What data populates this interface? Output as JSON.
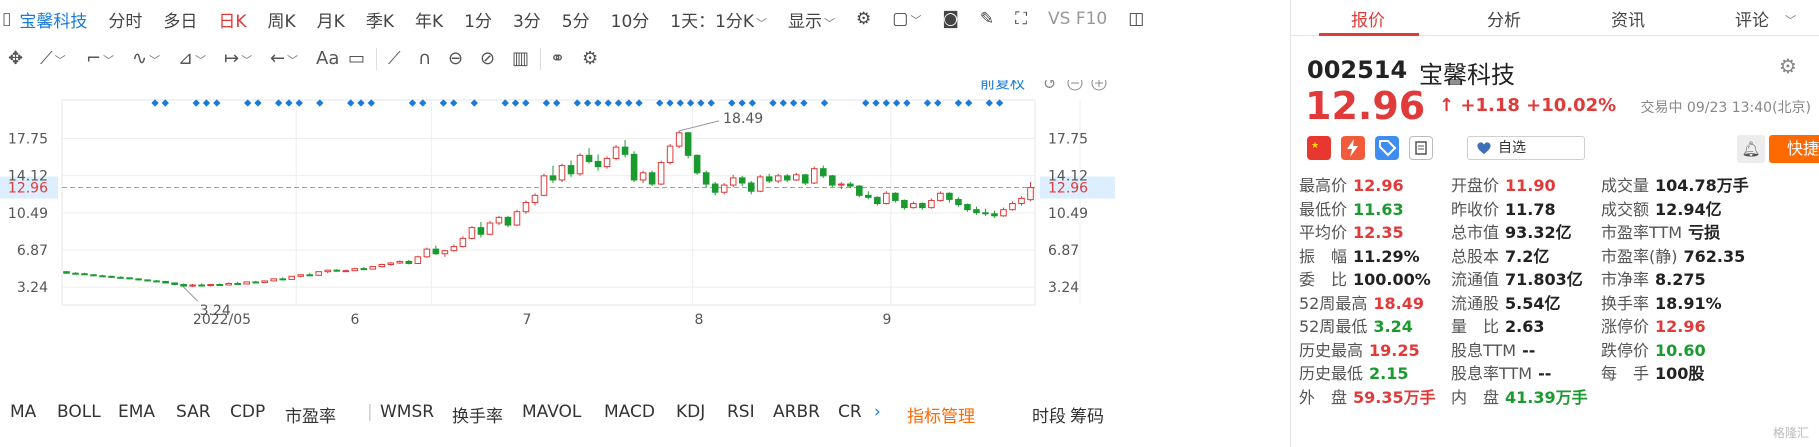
{
  "header": {
    "stock_name": "宝馨科技",
    "periods": [
      "分时",
      "多日",
      "日K",
      "周K",
      "月K",
      "季K",
      "年K",
      "1分",
      "3分",
      "5分",
      "10分",
      "1天：1分K"
    ],
    "active_period": "日K",
    "display_label": "显示",
    "vs_label": "VS F10"
  },
  "chart": {
    "adjust_label": "前复权",
    "price_ticks": [
      "17.75",
      "14.12",
      "10.49",
      "6.87",
      "3.24"
    ],
    "current_price_tag": "12.96",
    "x_ticks": [
      "2022/05",
      "6",
      "7",
      "8",
      "9"
    ],
    "high_label": "18.49",
    "low_label": "3.24",
    "colors": {
      "up": "#e03a3a",
      "down": "#1a9a2f",
      "marker": "#1a7ad9",
      "price_line": "#ff8c1a"
    }
  },
  "chart_data": {
    "type": "candlestick",
    "ylim": [
      1.5,
      21.5
    ],
    "x_axis_ticks": [
      "2022/05",
      "6",
      "7",
      "8",
      "9"
    ],
    "y_axis_ticks": [
      3.24,
      6.87,
      10.49,
      14.12,
      17.75
    ],
    "current_price": 12.96,
    "marked_high": 18.49,
    "marked_low": 3.24,
    "ohlc": [
      [
        4.75,
        4.8,
        4.55,
        4.6
      ],
      [
        4.6,
        4.7,
        4.5,
        4.55
      ],
      [
        4.55,
        4.65,
        4.4,
        4.45
      ],
      [
        4.45,
        4.5,
        4.3,
        4.35
      ],
      [
        4.35,
        4.45,
        4.25,
        4.3
      ],
      [
        4.3,
        4.35,
        4.15,
        4.2
      ],
      [
        4.2,
        4.3,
        4.1,
        4.15
      ],
      [
        4.15,
        4.2,
        4.0,
        4.05
      ],
      [
        4.05,
        4.1,
        3.9,
        3.95
      ],
      [
        3.95,
        4.0,
        3.8,
        3.85
      ],
      [
        3.85,
        3.95,
        3.75,
        3.8
      ],
      [
        3.8,
        3.85,
        3.6,
        3.65
      ],
      [
        3.65,
        3.7,
        3.45,
        3.5
      ],
      [
        3.5,
        3.6,
        3.24,
        3.35
      ],
      [
        3.35,
        3.55,
        3.25,
        3.45
      ],
      [
        3.45,
        3.6,
        3.35,
        3.4
      ],
      [
        3.4,
        3.55,
        3.3,
        3.5
      ],
      [
        3.5,
        3.6,
        3.35,
        3.45
      ],
      [
        3.45,
        3.7,
        3.4,
        3.6
      ],
      [
        3.6,
        3.75,
        3.5,
        3.55
      ],
      [
        3.55,
        3.8,
        3.5,
        3.75
      ],
      [
        3.75,
        3.85,
        3.6,
        3.7
      ],
      [
        3.7,
        3.9,
        3.65,
        3.85
      ],
      [
        3.85,
        4.1,
        3.8,
        4.05
      ],
      [
        4.05,
        4.2,
        3.9,
        4.0
      ],
      [
        4.0,
        4.35,
        3.95,
        4.3
      ],
      [
        4.3,
        4.5,
        4.2,
        4.45
      ],
      [
        4.45,
        4.6,
        4.3,
        4.4
      ],
      [
        4.4,
        4.8,
        4.35,
        4.75
      ],
      [
        4.75,
        4.95,
        4.6,
        4.9
      ],
      [
        4.9,
        5.0,
        4.75,
        4.8
      ],
      [
        4.8,
        4.95,
        4.7,
        4.85
      ],
      [
        4.85,
        5.1,
        4.8,
        5.05
      ],
      [
        5.05,
        5.2,
        4.9,
        5.0
      ],
      [
        5.0,
        5.3,
        4.95,
        5.25
      ],
      [
        5.25,
        5.55,
        5.15,
        5.45
      ],
      [
        5.45,
        5.7,
        5.3,
        5.6
      ],
      [
        5.6,
        5.85,
        5.5,
        5.75
      ],
      [
        5.75,
        5.9,
        5.45,
        5.55
      ],
      [
        5.55,
        6.3,
        5.5,
        6.2
      ],
      [
        6.2,
        7.1,
        6.1,
        6.95
      ],
      [
        6.95,
        7.3,
        6.4,
        6.5
      ],
      [
        6.5,
        6.9,
        6.2,
        6.8
      ],
      [
        6.8,
        7.4,
        6.7,
        7.2
      ],
      [
        7.2,
        8.2,
        7.1,
        8.0
      ],
      [
        8.0,
        9.2,
        7.9,
        9.05
      ],
      [
        9.05,
        9.6,
        8.1,
        8.4
      ],
      [
        8.4,
        9.7,
        8.3,
        9.5
      ],
      [
        9.5,
        10.2,
        9.3,
        10.05
      ],
      [
        10.05,
        10.2,
        9.1,
        9.3
      ],
      [
        9.3,
        10.8,
        9.2,
        10.6
      ],
      [
        10.6,
        11.7,
        10.4,
        11.5
      ],
      [
        11.5,
        12.4,
        11.2,
        12.2
      ],
      [
        12.2,
        14.3,
        12.1,
        14.1
      ],
      [
        14.1,
        15.1,
        13.4,
        13.7
      ],
      [
        13.7,
        15.3,
        13.5,
        15.1
      ],
      [
        15.1,
        15.6,
        14.0,
        14.3
      ],
      [
        14.3,
        16.3,
        14.1,
        16.1
      ],
      [
        16.1,
        16.8,
        15.3,
        15.5
      ],
      [
        15.5,
        16.2,
        14.6,
        15.0
      ],
      [
        15.0,
        16.0,
        14.8,
        15.8
      ],
      [
        15.8,
        17.1,
        15.6,
        16.9
      ],
      [
        16.9,
        17.6,
        15.9,
        16.2
      ],
      [
        16.2,
        16.5,
        13.5,
        13.7
      ],
      [
        13.7,
        14.6,
        13.4,
        14.4
      ],
      [
        14.4,
        14.6,
        13.1,
        13.3
      ],
      [
        13.3,
        15.6,
        13.2,
        15.4
      ],
      [
        15.4,
        17.2,
        15.2,
        17.0
      ],
      [
        17.0,
        18.49,
        16.8,
        18.3
      ],
      [
        18.3,
        18.4,
        15.8,
        16.1
      ],
      [
        16.1,
        16.2,
        14.2,
        14.4
      ],
      [
        14.4,
        14.6,
        13.0,
        13.3
      ],
      [
        13.3,
        13.5,
        12.2,
        12.5
      ],
      [
        12.5,
        13.4,
        12.3,
        13.2
      ],
      [
        13.2,
        14.2,
        13.0,
        13.9
      ],
      [
        13.9,
        14.1,
        13.1,
        13.4
      ],
      [
        13.4,
        13.6,
        12.3,
        12.6
      ],
      [
        12.6,
        14.2,
        12.5,
        14.0
      ],
      [
        14.0,
        14.3,
        13.4,
        13.6
      ],
      [
        13.6,
        14.3,
        13.4,
        14.1
      ],
      [
        14.1,
        14.3,
        13.5,
        13.7
      ],
      [
        13.7,
        14.4,
        13.6,
        14.2
      ],
      [
        14.2,
        14.3,
        13.2,
        13.4
      ],
      [
        13.4,
        15.0,
        13.3,
        14.8
      ],
      [
        14.8,
        15.1,
        13.9,
        14.1
      ],
      [
        14.1,
        14.2,
        13.0,
        13.2
      ],
      [
        13.2,
        13.5,
        12.8,
        13.3
      ],
      [
        13.3,
        13.5,
        12.9,
        13.1
      ],
      [
        13.1,
        13.2,
        12.0,
        12.2
      ],
      [
        12.2,
        12.6,
        11.8,
        12.0
      ],
      [
        12.0,
        12.1,
        11.2,
        11.4
      ],
      [
        11.4,
        12.6,
        11.3,
        12.4
      ],
      [
        12.4,
        12.5,
        11.5,
        11.7
      ],
      [
        11.7,
        11.8,
        10.8,
        11.0
      ],
      [
        11.0,
        11.6,
        10.9,
        11.4
      ],
      [
        11.4,
        11.5,
        10.8,
        11.0
      ],
      [
        11.0,
        11.9,
        10.9,
        11.7
      ],
      [
        11.7,
        12.6,
        11.6,
        12.4
      ],
      [
        12.4,
        12.5,
        11.5,
        11.8
      ],
      [
        11.8,
        12.0,
        11.1,
        11.3
      ],
      [
        11.3,
        11.4,
        10.6,
        10.8
      ],
      [
        10.8,
        11.1,
        10.3,
        10.5
      ],
      [
        10.5,
        10.9,
        10.2,
        10.4
      ],
      [
        10.4,
        10.7,
        10.0,
        10.2
      ],
      [
        10.2,
        11.0,
        10.1,
        10.8
      ],
      [
        10.8,
        11.6,
        10.7,
        11.4
      ],
      [
        11.4,
        12.1,
        11.2,
        11.9
      ],
      [
        11.78,
        13.5,
        11.63,
        12.96
      ]
    ],
    "signal_marker_groups": [
      [
        0,
        1
      ],
      [
        4,
        5,
        6
      ],
      [
        9,
        10
      ],
      [
        12,
        13,
        14
      ],
      [
        16
      ],
      [
        19,
        20,
        21
      ],
      [
        25,
        26
      ],
      [
        28,
        29
      ],
      [
        31
      ],
      [
        34,
        35,
        36
      ],
      [
        38,
        39
      ],
      [
        41,
        42,
        43,
        44,
        45,
        46,
        47
      ],
      [
        49,
        50,
        51,
        52,
        53,
        54
      ],
      [
        56,
        57,
        58
      ],
      [
        60,
        61,
        62,
        63
      ],
      [
        65
      ],
      [
        69,
        70,
        71,
        72,
        73
      ],
      [
        75,
        76
      ],
      [
        78,
        79
      ],
      [
        81,
        82
      ]
    ]
  },
  "toolbar_bottom": {
    "indicators": [
      "MA",
      "BOLL",
      "EMA",
      "SAR",
      "CDP",
      "市盈率",
      "WMSR",
      "换手率",
      "MAVOL",
      "MACD",
      "KDJ",
      "RSI",
      "ARBR",
      "CR"
    ],
    "manage_label": "指标管理",
    "right_labels": [
      "时段",
      "筹码"
    ]
  },
  "quote": {
    "tabs": [
      "报价",
      "分析",
      "资讯",
      "评论"
    ],
    "active_tab": "报价",
    "code": "002514",
    "name": "宝馨科技",
    "price": "12.96",
    "arrow": "↑",
    "change": "+1.18",
    "change_pct": "+10.02%",
    "status": "交易中 09/23 13:40(北京)",
    "watch_label": "自选",
    "trade_label": "快捷交易",
    "fields": [
      {
        "label": "最高价",
        "value": "12.96",
        "tone": "red"
      },
      {
        "label": "开盘价",
        "value": "11.90",
        "tone": "red"
      },
      {
        "label": "成交量",
        "value": "104.78万手",
        "tone": "dark"
      },
      {
        "label": "最低价",
        "value": "11.63",
        "tone": "green"
      },
      {
        "label": "昨收价",
        "value": "11.78",
        "tone": "dark"
      },
      {
        "label": "成交额",
        "value": "12.94亿",
        "tone": "dark"
      },
      {
        "label": "平均价",
        "value": "12.35",
        "tone": "red"
      },
      {
        "label": "总市值",
        "value": "93.32亿",
        "tone": "dark"
      },
      {
        "label": "市盈率TTM",
        "value": "亏损",
        "tone": "dark"
      },
      {
        "label": "振　幅",
        "value": "11.29%",
        "tone": "dark"
      },
      {
        "label": "总股本",
        "value": "7.2亿",
        "tone": "dark"
      },
      {
        "label": "市盈率(静)",
        "value": "762.35",
        "tone": "dark"
      },
      {
        "label": "委　比",
        "value": "100.00%",
        "tone": "dark"
      },
      {
        "label": "流通值",
        "value": "71.803亿",
        "tone": "dark"
      },
      {
        "label": "市净率",
        "value": "8.275",
        "tone": "dark"
      },
      {
        "label": "52周最高",
        "value": "18.49",
        "tone": "red"
      },
      {
        "label": "流通股",
        "value": "5.54亿",
        "tone": "dark"
      },
      {
        "label": "换手率",
        "value": "18.91%",
        "tone": "dark"
      },
      {
        "label": "52周最低",
        "value": "3.24",
        "tone": "green"
      },
      {
        "label": "量　比",
        "value": "2.63",
        "tone": "dark"
      },
      {
        "label": "涨停价",
        "value": "12.96",
        "tone": "red"
      },
      {
        "label": "历史最高",
        "value": "19.25",
        "tone": "red"
      },
      {
        "label": "股息TTM",
        "value": "--",
        "tone": "dark"
      },
      {
        "label": "跌停价",
        "value": "10.60",
        "tone": "green"
      },
      {
        "label": "历史最低",
        "value": "2.15",
        "tone": "green"
      },
      {
        "label": "股息率TTM",
        "value": "--",
        "tone": "dark"
      },
      {
        "label": "每　手",
        "value": "100股",
        "tone": "dark"
      },
      {
        "label": "外　盘",
        "value": "59.35万手",
        "tone": "red"
      },
      {
        "label": "内　盘",
        "value": "41.39万手",
        "tone": "green"
      }
    ],
    "watermark": "格隆汇"
  }
}
